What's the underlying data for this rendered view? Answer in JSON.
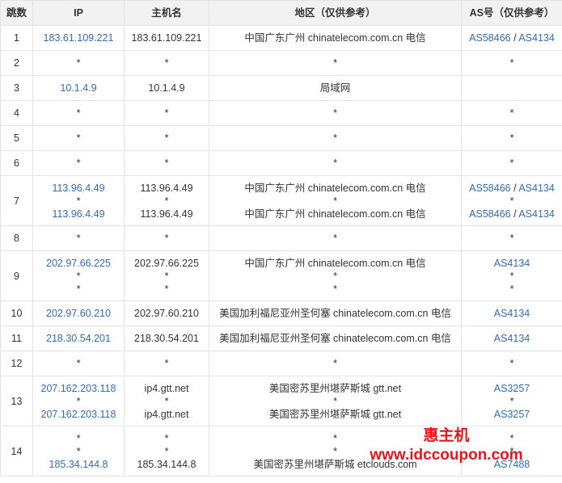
{
  "headers": {
    "hop": "跳数",
    "ip": "IP",
    "host": "主机名",
    "region": "地区（仅供参考）",
    "as": "AS号（仅供参考）"
  },
  "rows": [
    {
      "hop": "1",
      "lines": [
        {
          "ip": "183.61.109.221",
          "host": "183.61.109.221",
          "region": "中国广东广州 chinatelecom.com.cn 电信",
          "as": [
            "AS58466",
            "AS4134"
          ]
        }
      ]
    },
    {
      "hop": "2",
      "lines": [
        {
          "ip": "*",
          "host": "*",
          "region": "*",
          "as": [
            "*"
          ]
        }
      ]
    },
    {
      "hop": "3",
      "lines": [
        {
          "ip": "10.1.4.9",
          "host": "10.1.4.9",
          "region": "局域网",
          "as": []
        }
      ]
    },
    {
      "hop": "4",
      "lines": [
        {
          "ip": "*",
          "host": "*",
          "region": "*",
          "as": [
            "*"
          ]
        }
      ]
    },
    {
      "hop": "5",
      "lines": [
        {
          "ip": "*",
          "host": "*",
          "region": "*",
          "as": [
            "*"
          ]
        }
      ]
    },
    {
      "hop": "6",
      "lines": [
        {
          "ip": "*",
          "host": "*",
          "region": "*",
          "as": [
            "*"
          ]
        }
      ]
    },
    {
      "hop": "7",
      "lines": [
        {
          "ip": "113.96.4.49",
          "host": "113.96.4.49",
          "region": "中国广东广州 chinatelecom.com.cn 电信",
          "as": [
            "AS58466",
            "AS4134"
          ]
        },
        {
          "ip": "*",
          "host": "*",
          "region": "*",
          "as": [
            "*"
          ]
        },
        {
          "ip": "113.96.4.49",
          "host": "113.96.4.49",
          "region": "中国广东广州 chinatelecom.com.cn 电信",
          "as": [
            "AS58466",
            "AS4134"
          ]
        }
      ]
    },
    {
      "hop": "8",
      "lines": [
        {
          "ip": "*",
          "host": "*",
          "region": "*",
          "as": [
            "*"
          ]
        }
      ]
    },
    {
      "hop": "9",
      "lines": [
        {
          "ip": "202.97.66.225",
          "host": "202.97.66.225",
          "region": "中国广东广州 chinatelecom.com.cn 电信",
          "as": [
            "AS4134"
          ]
        },
        {
          "ip": "*",
          "host": "*",
          "region": "*",
          "as": [
            "*"
          ]
        },
        {
          "ip": "*",
          "host": "*",
          "region": "*",
          "as": [
            "*"
          ]
        }
      ]
    },
    {
      "hop": "10",
      "lines": [
        {
          "ip": "202.97.60.210",
          "host": "202.97.60.210",
          "region": "美国加利福尼亚州圣何塞 chinatelecom.com.cn 电信",
          "as": [
            "AS4134"
          ]
        }
      ]
    },
    {
      "hop": "11",
      "lines": [
        {
          "ip": "218.30.54.201",
          "host": "218.30.54.201",
          "region": "美国加利福尼亚州圣何塞 chinatelecom.com.cn 电信",
          "as": [
            "AS4134"
          ]
        }
      ]
    },
    {
      "hop": "12",
      "lines": [
        {
          "ip": "*",
          "host": "*",
          "region": "*",
          "as": [
            "*"
          ]
        }
      ]
    },
    {
      "hop": "13",
      "lines": [
        {
          "ip": "207.162.203.118",
          "host": "ip4.gtt.net",
          "region": "美国密苏里州堪萨斯城 gtt.net",
          "as": [
            "AS3257"
          ]
        },
        {
          "ip": "*",
          "host": "*",
          "region": "*",
          "as": [
            "*"
          ]
        },
        {
          "ip": "207.162.203.118",
          "host": "ip4.gtt.net",
          "region": "美国密苏里州堪萨斯城 gtt.net",
          "as": [
            "AS3257"
          ]
        }
      ]
    },
    {
      "hop": "14",
      "lines": [
        {
          "ip": "*",
          "host": "*",
          "region": "*",
          "as": [
            "*"
          ]
        },
        {
          "ip": "*",
          "host": "*",
          "region": "*",
          "as": [
            "*"
          ]
        },
        {
          "ip": "185.34.144.8",
          "host": "185.34.144.8",
          "region": "美国密苏里州堪萨斯城 etclouds.com",
          "as": [
            "AS7488"
          ]
        }
      ]
    }
  ],
  "watermark": {
    "title": "惠主机",
    "url": "www.idccoupon.com"
  },
  "colors": {
    "link": "#2f6db5",
    "header_bg": "#f2f2f2",
    "border": "#e3e3e3",
    "watermark": "#e8141b"
  }
}
